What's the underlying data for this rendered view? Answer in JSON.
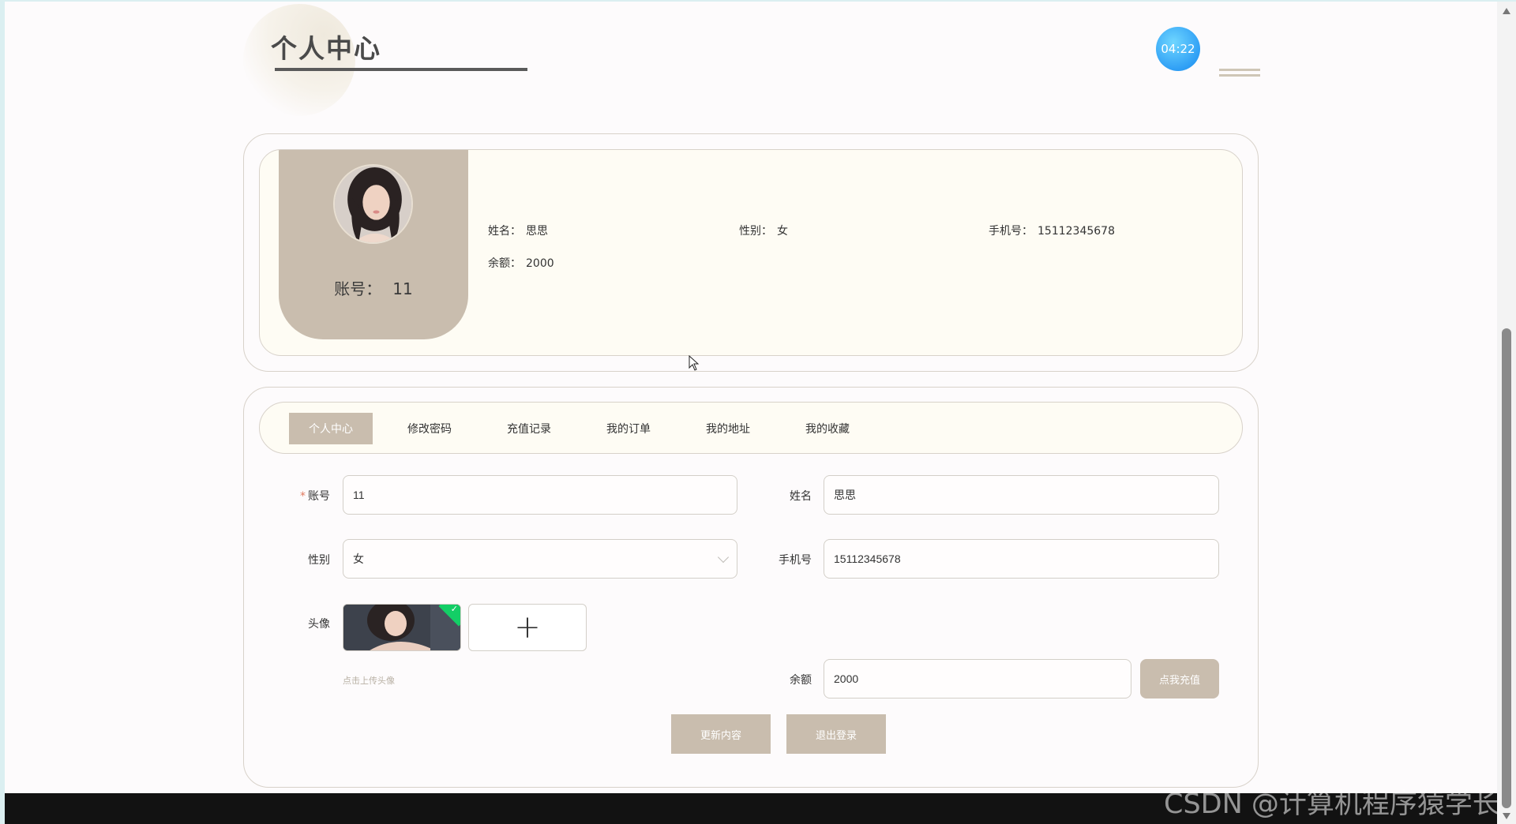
{
  "header": {
    "title": "个人中心",
    "clock_time": "04:22"
  },
  "profile": {
    "account_label": "账号：",
    "account_value": "11",
    "fields": [
      {
        "label": "姓名：",
        "value": "思思"
      },
      {
        "label": "性别：",
        "value": "女"
      },
      {
        "label": "手机号：",
        "value": "15112345678"
      },
      {
        "label": "余额：",
        "value": "2000"
      }
    ]
  },
  "tabs": [
    {
      "label": "个人中心",
      "active": true
    },
    {
      "label": "修改密码",
      "active": false
    },
    {
      "label": "充值记录",
      "active": false
    },
    {
      "label": "我的订单",
      "active": false
    },
    {
      "label": "我的地址",
      "active": false
    },
    {
      "label": "我的收藏",
      "active": false
    }
  ],
  "form": {
    "account": {
      "label": "账号",
      "required_mark": "*",
      "value": "11"
    },
    "name": {
      "label": "姓名",
      "value": "思思"
    },
    "gender": {
      "label": "性别",
      "value": "女"
    },
    "phone": {
      "label": "手机号",
      "value": "15112345678"
    },
    "avatar": {
      "label": "头像",
      "upload_plus": "+",
      "tip": "点击上传头像"
    },
    "balance": {
      "label": "余额",
      "value": "2000"
    },
    "recharge_button": "点我充值",
    "update_button": "更新内容",
    "logout_button": "退出登录"
  },
  "watermark": "CSDN @计算机程序猿学长",
  "colors": {
    "accent": "#c9bdae",
    "card_bg": "#fefcf4",
    "clock": "#2f9ff5",
    "success": "#13ce66"
  }
}
